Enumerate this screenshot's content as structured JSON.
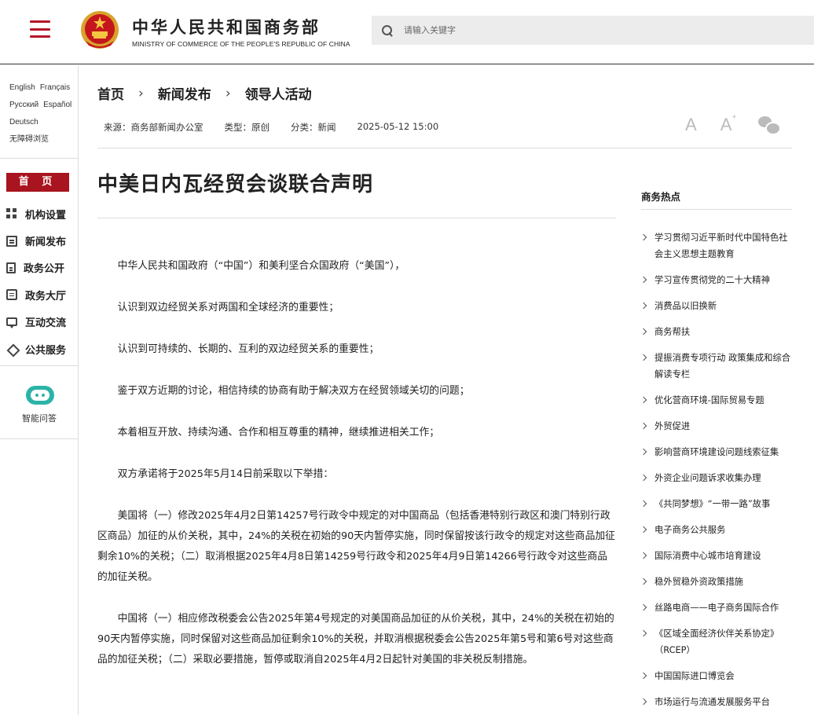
{
  "header": {
    "site_name": "中华人民共和国商务部",
    "site_name_en": "MINISTRY OF COMMERCE OF THE PEOPLE'S REPUBLIC OF CHINA",
    "search_placeholder": "请输入关键字",
    "brand_color": "#b5162a"
  },
  "sidebar": {
    "languages": [
      "English",
      "Français",
      "Русский",
      "Español",
      "Deutsch",
      "无障碍浏览"
    ],
    "home_label": "首 页",
    "nav": [
      {
        "label": "机构设置",
        "icon": "grid-icon"
      },
      {
        "label": "新闻发布",
        "icon": "news-icon"
      },
      {
        "label": "政务公开",
        "icon": "document-icon"
      },
      {
        "label": "政务大厅",
        "icon": "hall-icon"
      },
      {
        "label": "互动交流",
        "icon": "chat-icon"
      },
      {
        "label": "公共服务",
        "icon": "service-icon"
      }
    ],
    "assistant_label": "智能问答"
  },
  "breadcrumb": [
    "首页",
    "新闻发布",
    "领导人活动"
  ],
  "meta": {
    "source": "来源：商务部新闻办公室",
    "type": "类型：原创",
    "category": "分类：新闻",
    "datetime": "2025-05-12 15:00"
  },
  "tools": {
    "font_small": "A",
    "font_large": "A",
    "font_large_sup": "+"
  },
  "article": {
    "title": "中美日内瓦经贸会谈联合声明",
    "paragraphs": [
      "中华人民共和国政府（“中国”）和美利坚合众国政府（“美国”），",
      "认识到双边经贸关系对两国和全球经济的重要性；",
      "认识到可持续的、长期的、互利的双边经贸关系的重要性；",
      "鉴于双方近期的讨论，相信持续的协商有助于解决双方在经贸领域关切的问题；",
      "本着相互开放、持续沟通、合作和相互尊重的精神，继续推进相关工作；",
      "双方承诺将于2025年5月14日前采取以下举措：",
      "美国将（一）修改2025年4月2日第14257号行政令中规定的对中国商品（包括香港特别行政区和澳门特别行政区商品）加征的从价关税，其中，24%的关税在初始的90天内暂停实施，同时保留按该行政令的规定对这些商品加征剩余10%的关税；（二）取消根据2025年4月8日第14259号行政令和2025年4月9日第14266号行政令对这些商品的加征关税。",
      "中国将（一）相应修改税委会公告2025年第4号规定的对美国商品加征的从价关税，其中，24%的关税在初始的90天内暂停实施，同时保留对这些商品加征剩余10%的关税，并取消根据税委会公告2025年第5号和第6号对这些商品的加征关税；（二）采取必要措施，暂停或取消自2025年4月2日起针对美国的非关税反制措施。"
    ]
  },
  "hot": {
    "title": "商务热点",
    "items": [
      "学习贯彻习近平新时代中国特色社会主义思想主题教育",
      "学习宣传贯彻党的二十大精神",
      "消费品以旧换新",
      "商务帮扶",
      "提振消费专项行动 政策集成和综合解读专栏",
      "优化营商环境-国际贸易专题",
      "外贸促进",
      "影响营商环境建设问题线索征集",
      "外资企业问题诉求收集办理",
      "《共同梦想》“一带一路”故事",
      "电子商务公共服务",
      "国际消费中心城市培育建设",
      "稳外贸稳外资政策措施",
      "丝路电商——电子商务国际合作",
      "《区域全面经济伙伴关系协定》（RCEP）",
      "中国国际进口博览会",
      "市场运行与流通发展服务平台"
    ]
  }
}
